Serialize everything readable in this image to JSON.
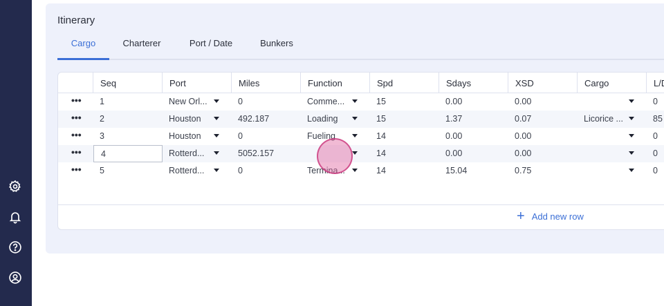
{
  "panel": {
    "title": "Itinerary"
  },
  "tabs": [
    {
      "label": "Cargo",
      "active": true
    },
    {
      "label": "Charterer",
      "active": false
    },
    {
      "label": "Port / Date",
      "active": false
    },
    {
      "label": "Bunkers",
      "active": false
    }
  ],
  "sidebar": {
    "icons": [
      "gear-icon",
      "bell-icon",
      "help-icon",
      "user-circle-icon"
    ]
  },
  "table": {
    "columns": [
      "Seq",
      "Port",
      "Miles",
      "Function",
      "Spd",
      "Sdays",
      "XSD",
      "Cargo",
      "L/D"
    ],
    "rows": [
      {
        "menu": "•••",
        "seq": "1",
        "port": "New Orl...",
        "miles": "0",
        "function": "Comme...",
        "spd": "15",
        "sdays": "0.00",
        "xsd": "0.00",
        "cargo": "",
        "ld": "0"
      },
      {
        "menu": "•••",
        "seq": "2",
        "port": "Houston",
        "miles": "492.187",
        "function": "Loading",
        "spd": "15",
        "sdays": "1.37",
        "xsd": "0.07",
        "cargo": "Licorice ...",
        "ld": "85"
      },
      {
        "menu": "•••",
        "seq": "3",
        "port": "Houston",
        "miles": "0",
        "function": "Fueling",
        "spd": "14",
        "sdays": "0.00",
        "xsd": "0.00",
        "cargo": "",
        "ld": "0"
      },
      {
        "menu": "•••",
        "seq": "4",
        "port": "Rotterd...",
        "miles": "5052.157",
        "function": "",
        "spd": "14",
        "sdays": "0.00",
        "xsd": "0.00",
        "cargo": "",
        "ld": "0"
      },
      {
        "menu": "•••",
        "seq": "5",
        "port": "Rotterd...",
        "miles": "0",
        "function": "Termina...",
        "spd": "14",
        "sdays": "15.04",
        "xsd": "0.75",
        "cargo": "",
        "ld": "0"
      }
    ],
    "add_row_label": "Add new row"
  },
  "colors": {
    "sidebar": "#232a4d",
    "accent": "#3b6fd6",
    "panel": "#eef1fb"
  }
}
